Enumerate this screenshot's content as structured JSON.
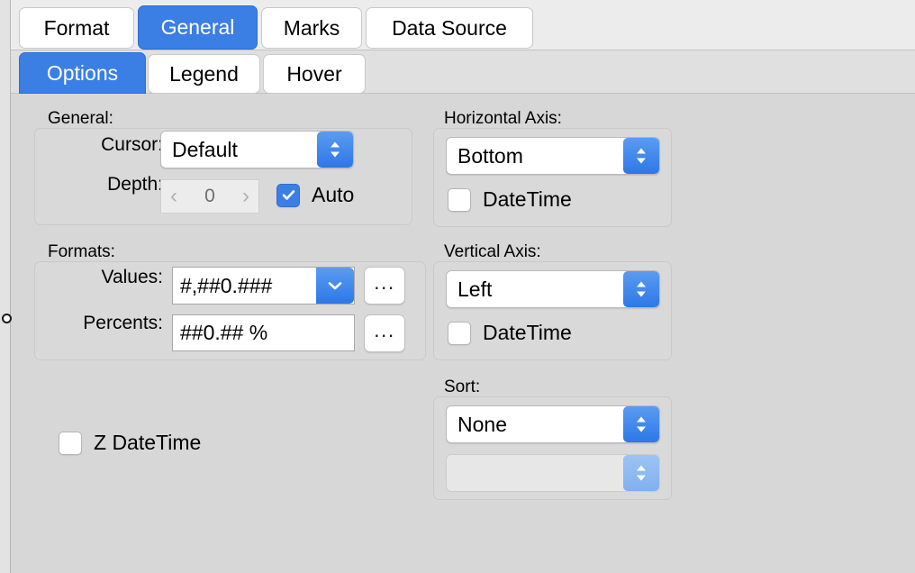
{
  "tabs": {
    "primary": [
      {
        "label": "Format",
        "selected": false
      },
      {
        "label": "General",
        "selected": true
      },
      {
        "label": "Marks",
        "selected": false
      },
      {
        "label": "Data Source",
        "selected": false
      }
    ],
    "secondary": [
      {
        "label": "Options",
        "selected": true
      },
      {
        "label": "Legend",
        "selected": false
      },
      {
        "label": "Hover",
        "selected": false
      }
    ]
  },
  "left_column": {
    "general": {
      "caption": "General:",
      "cursor": {
        "label": "Cursor:",
        "value": "Default",
        "arrow_icon": "chevron-up-down-icon"
      },
      "depth": {
        "label": "Depth:",
        "value": "0",
        "prev_icon": "chevron-left-icon",
        "next_icon": "chevron-right-icon",
        "auto_label": "Auto",
        "auto_checked": true
      }
    },
    "formats": {
      "caption": "Formats:",
      "values": {
        "label": "Values:",
        "value": "#,##0.###",
        "arrow_icon": "chevron-down-icon",
        "more_label": "..."
      },
      "percents": {
        "label": "Percents:",
        "value": "##0.## %",
        "more_label": "..."
      }
    },
    "z_datetime": {
      "label": "Z DateTime",
      "checked": false
    }
  },
  "right_column": {
    "horizontal_axis": {
      "caption": "Horizontal Axis:",
      "position": "Bottom",
      "arrow_icon": "chevron-up-down-icon",
      "datetime_label": "DateTime",
      "datetime_checked": false
    },
    "vertical_axis": {
      "caption": "Vertical Axis:",
      "position": "Left",
      "arrow_icon": "chevron-up-down-icon",
      "datetime_label": "DateTime",
      "datetime_checked": false
    },
    "sort": {
      "caption": "Sort:",
      "mode": "None",
      "arrow_icon": "chevron-up-down-icon",
      "field": "",
      "field_disabled": true,
      "field_arrow_icon": "chevron-up-down-icon"
    }
  },
  "colors": {
    "accent": "#3b7fe4",
    "window_bg": "#d7d7d7",
    "tabstrip_bg": "#ececec"
  }
}
